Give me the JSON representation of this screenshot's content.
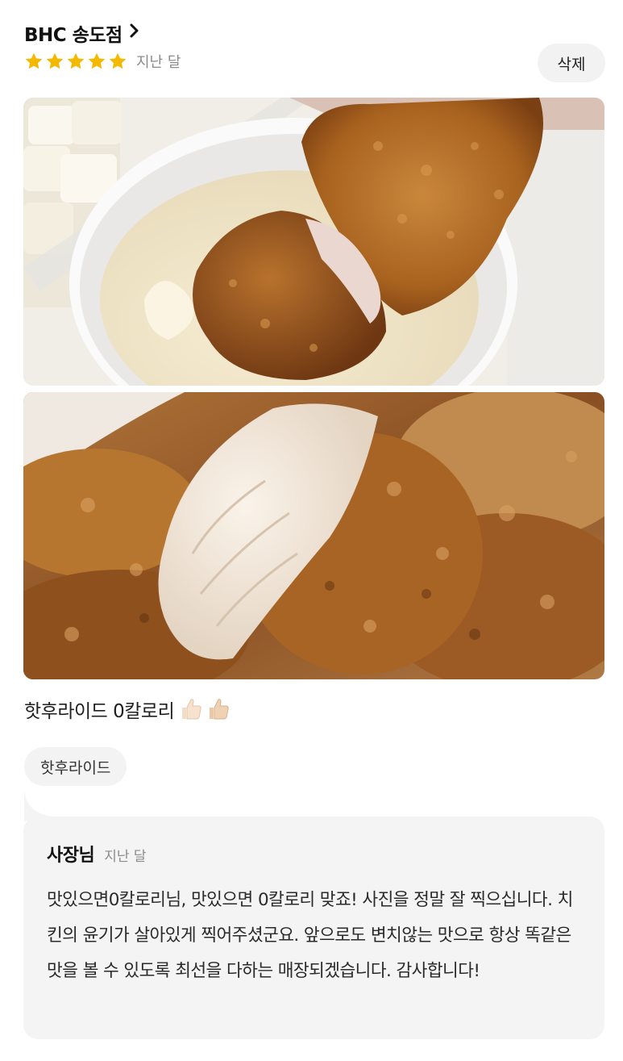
{
  "review": {
    "store_name": "BHC 송도점",
    "store_chevron": "›",
    "rating": 5,
    "date": "지난 달",
    "delete_label": "삭제",
    "text": "핫후라이드 0칼로리",
    "menu_tag": "핫후라이드",
    "photos": [
      {
        "icon": "fried-chicken-with-sauce-photo"
      },
      {
        "icon": "fried-chicken-closeup-photo"
      }
    ]
  },
  "owner_reply": {
    "author": "사장님",
    "date": "지난 달",
    "body": "맛있으면0칼로리님, 맛있으면 0칼로리 맞죠! 사진을 정말 잘 찍으십니다. 치킨의 윤기가 살아있게 찍어주셨군요. 앞으로도 변치않는 맛으로 항상 똑같은 맛을 볼 수 있도록 최선을 다하는 매장되겠습니다. 감사합니다!"
  },
  "colors": {
    "star": "#f5b800",
    "chip_bg": "#f3f3f3",
    "reply_bg": "#f4f4f4",
    "muted_text": "#8c8c8c"
  }
}
